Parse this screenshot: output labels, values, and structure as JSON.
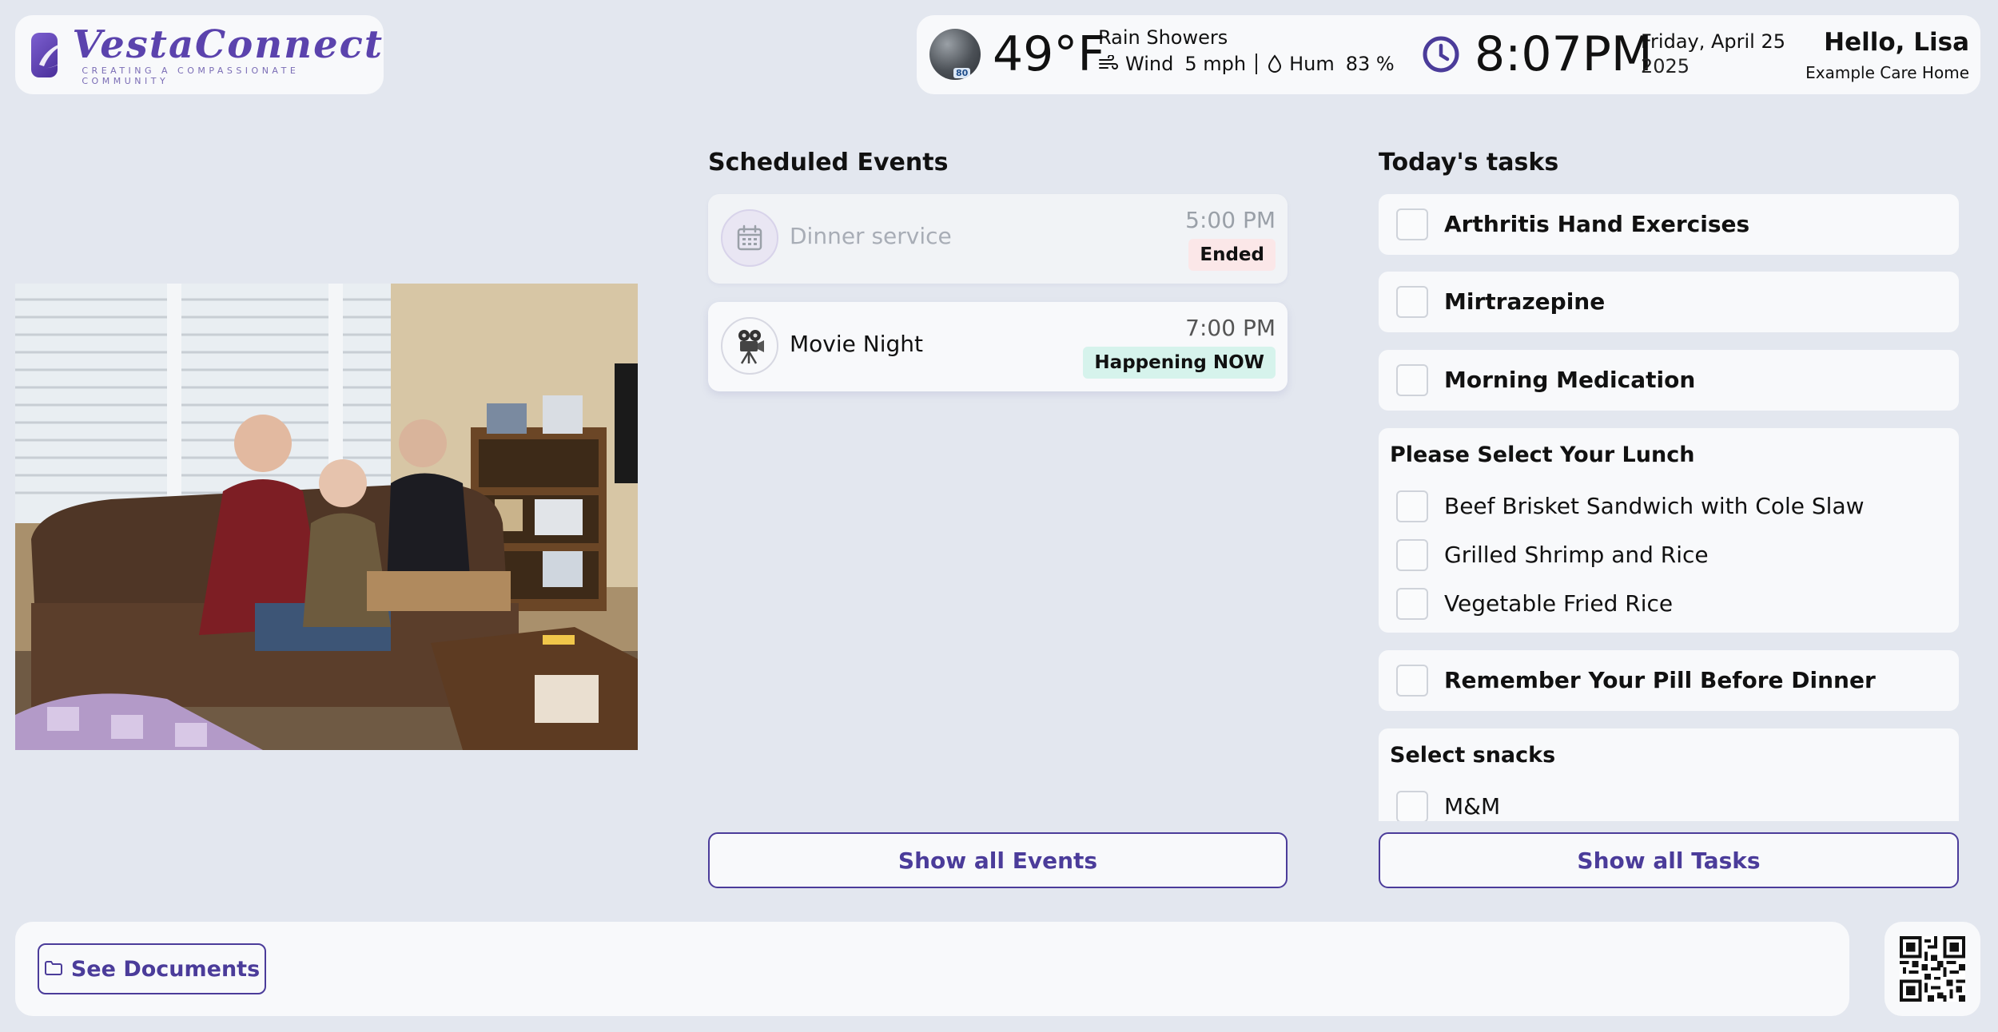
{
  "brand": {
    "name": "VestaConnect",
    "tagline": "CREATING A COMPASSIONATE COMMUNITY"
  },
  "weather": {
    "icon": "rain-showers-icon",
    "uv_badge": "80",
    "temperature": "49°F",
    "condition": "Rain Showers",
    "wind_label": "Wind",
    "wind_value": "5 mph",
    "humidity_label": "Hum",
    "humidity_value": "83 %"
  },
  "clock": {
    "time": "8:07PM",
    "date_line": "Friday, April 25",
    "year": "2025"
  },
  "user": {
    "greeting": "Hello, Lisa",
    "facility": "Example Care Home"
  },
  "events": {
    "title": "Scheduled Events",
    "items": [
      {
        "name": "Dinner service",
        "time": "5:00 PM",
        "status": "Ended",
        "icon": "calendar-icon"
      },
      {
        "name": "Movie Night",
        "time": "7:00 PM",
        "status": "Happening NOW",
        "icon": "movie-camera-icon"
      }
    ],
    "show_all_label": "Show all Events"
  },
  "tasks": {
    "title": "Today's tasks",
    "items": [
      {
        "label": "Arthritis Hand Exercises",
        "checked": false
      },
      {
        "label": "Mirtrazepine",
        "checked": false
      },
      {
        "label": "Morning Medication",
        "checked": false
      }
    ],
    "lunch": {
      "title": "Please Select Your Lunch",
      "options": [
        "Beef Brisket Sandwich with Cole Slaw",
        "Grilled Shrimp and Rice",
        "Vegetable Fried Rice"
      ]
    },
    "pill_reminder": "Remember Your Pill Before Dinner",
    "snacks": {
      "title": "Select snacks",
      "options": [
        "M&M"
      ]
    },
    "show_all_label": "Show all Tasks"
  },
  "footer": {
    "documents_label": "See Documents"
  },
  "colors": {
    "accent": "#4b3c9a",
    "background": "#e3e7ef",
    "card": "#f8f9fb",
    "ended_badge": "#fbe7e8",
    "now_badge": "#d6f3ec"
  }
}
